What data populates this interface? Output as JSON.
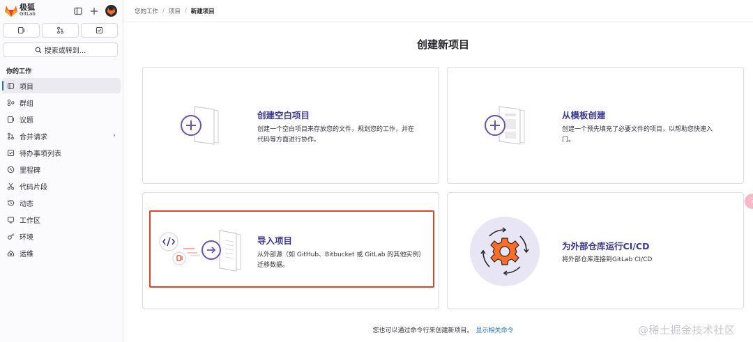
{
  "app": {
    "brand_name": "极狐",
    "brand_sub": "GitLab"
  },
  "sidebar": {
    "search_label": "搜索或转到...",
    "section_title": "你的工作",
    "items": [
      {
        "label": "项目",
        "icon": "project-icon",
        "active": true
      },
      {
        "label": "群组",
        "icon": "group-icon"
      },
      {
        "label": "议题",
        "icon": "issues-icon"
      },
      {
        "label": "合并请求",
        "icon": "merge-request-icon",
        "has_chevron": true
      },
      {
        "label": "待办事项列表",
        "icon": "todo-icon"
      },
      {
        "label": "里程碑",
        "icon": "clock-icon"
      },
      {
        "label": "代码片段",
        "icon": "snippet-icon"
      },
      {
        "label": "动态",
        "icon": "history-icon"
      },
      {
        "label": "工作区",
        "icon": "workspace-icon"
      },
      {
        "label": "环境",
        "icon": "environment-icon"
      },
      {
        "label": "运维",
        "icon": "operations-icon"
      }
    ]
  },
  "breadcrumb": {
    "items": [
      "您的工作",
      "项目"
    ],
    "current": "新建项目"
  },
  "main": {
    "title": "创建新项目",
    "cards": [
      {
        "title": "创建空白项目",
        "desc_line1": "创建一个空白项目来存放您的文件，规划您的工作，并在",
        "desc_line2": "代码等方面进行协作。"
      },
      {
        "title": "从模板创建",
        "desc_line1": "创建一个预先填充了必要文件的项目，以帮助您快速入",
        "desc_line2": "门。"
      },
      {
        "title": "导入项目",
        "desc_line1": "从外部源（如 GitHub、Bitbucket 或 GitLab 的其他实例）",
        "desc_line2": "迁移数据。"
      },
      {
        "title": "为外部仓库运行CI/CD",
        "desc_line1": "将外部仓库连接到GitLab CI/CD",
        "desc_line2": ""
      }
    ],
    "footer_text": "您也可以通过命令行来创建新项目。",
    "footer_link": "显示相关命令"
  },
  "help_fab_glyph": "?",
  "watermark": "@稀土掘金技术社区",
  "colors": {
    "accent": "#3b3a8f",
    "link": "#1f75cb",
    "focus": "#e24329",
    "purple": "#6b4fbb"
  }
}
